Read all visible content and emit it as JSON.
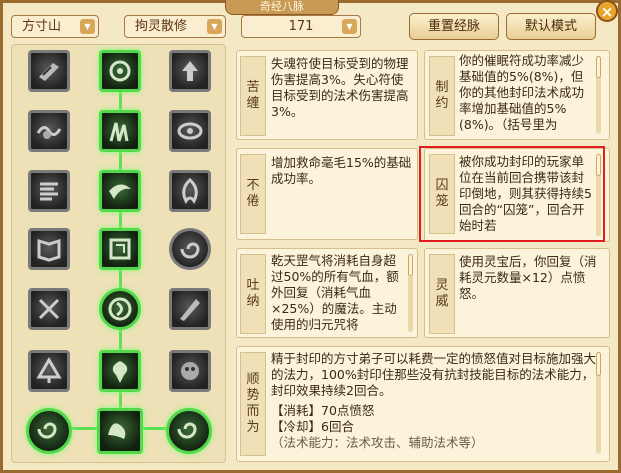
{
  "window": {
    "title": "奇经八脉",
    "close_label": "×"
  },
  "toolbar": {
    "school": "方寸山",
    "path": "拘灵散修",
    "level": "171",
    "reset_label": "重置经脉",
    "default_label": "默认模式"
  },
  "cards": {
    "kuchan": {
      "label": "苦缠",
      "text": "失魂符使目标受到的物理伤害提高3%。失心符使目标受到的法术伤害提高3%。"
    },
    "zhiyue": {
      "label": "制约",
      "text": "你的催眠符成功率减少基础值的5%(8%)，但你的其他封印法术成功率增加基础值的5%(8%)。（括号里为"
    },
    "bujuan": {
      "label": "不倦",
      "text": "增加救命毫毛15%的基础成功率。"
    },
    "qiulong": {
      "label": "囚笼",
      "text": "被你成功封印的玩家单位在当前回合携带该封印倒地，则其获得持续5回合的“囚笼”，回合开始时若"
    },
    "tuna": {
      "label": "吐纳",
      "text": "乾天罡气将消耗自身超过50%的所有气血，额外回复（消耗气血×25%）的魔法。主动使用的归元咒将"
    },
    "lingwei": {
      "label": "灵威",
      "text": "使用灵宝后，你回复（消耗灵元数量×12）点愤怒。"
    },
    "shunshi": {
      "label": "顺势而为",
      "text": "精于封印的方寸弟子可以耗费一定的愤怒值对目标施加强大的法力，100%封印住那些没有抗封技能目标的法术能力，封印效果持续2回合。",
      "cost": "【消耗】70点愤怒",
      "cooldown": "【冷却】6回合",
      "extra": "（法术能力：法术攻击、辅助法术等）"
    }
  },
  "background_chars": [
    "一",
    "寸"
  ]
}
